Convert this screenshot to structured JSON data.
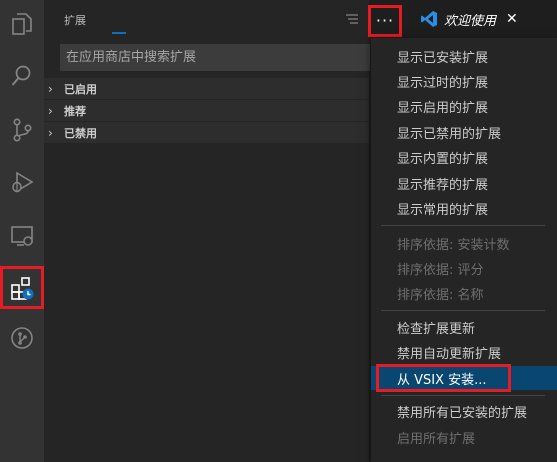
{
  "sidebar": {
    "title": "扩展",
    "search_placeholder": "在应用商店中搜索扩展",
    "sections": [
      {
        "label": "已启用"
      },
      {
        "label": "推荐"
      },
      {
        "label": "已禁用"
      }
    ]
  },
  "toolbar": {
    "more_label": "···"
  },
  "tab": {
    "label": "欢迎使用",
    "close": "✕"
  },
  "menu": {
    "groups": [
      [
        "显示已安装扩展",
        "显示过时的扩展",
        "显示启用的扩展",
        "显示已禁用的扩展",
        "显示内置的扩展",
        "显示推荐的扩展",
        "显示常用的扩展"
      ],
      [
        "排序依据: 安装计数",
        "排序依据: 评分",
        "排序依据: 名称"
      ],
      [
        "检查扩展更新",
        "禁用自动更新扩展",
        "从 VSIX 安装..."
      ],
      [
        "禁用所有已安装的扩展",
        "启用所有扩展"
      ]
    ]
  },
  "colors": {
    "highlight": "#e51c23",
    "accent": "#0e70c0",
    "selected": "#094771"
  }
}
